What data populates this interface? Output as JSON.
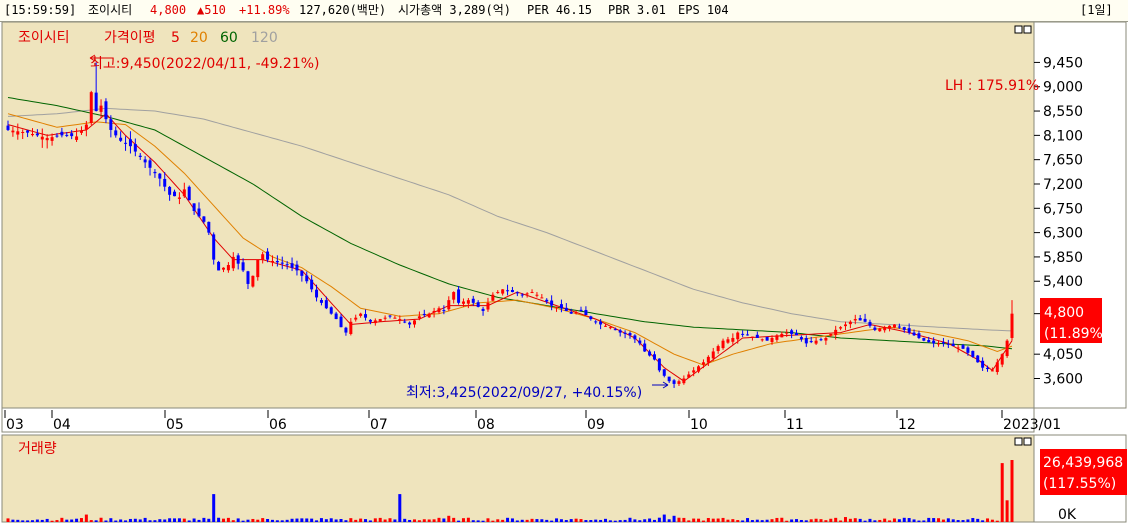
{
  "header": {
    "time": "[15:59:59]",
    "name": "조이시티",
    "price": "4,800",
    "change": "▲510",
    "change_pct": "+11.89%",
    "volume": "127,620(백만)",
    "market_cap": "시가총액  3,289(억)",
    "per": "PER 46.15",
    "pbr": "PBR 3.01",
    "eps": "EPS 104",
    "period": "[1일]"
  },
  "price_panel": {
    "title": "조이시티",
    "ma_label": "가격이평",
    "ma_periods": [
      "5",
      "20",
      "60",
      "120"
    ],
    "ma_colors": [
      "#e00000",
      "#e08000",
      "#006400",
      "#a0a0a0"
    ],
    "high_annotation": "최고:9,450(2022/04/11, -49.21%)",
    "low_annotation": "최저:3,425(2022/09/27, +40.15%)",
    "lh_label": "LH : 175.91%",
    "current_price": "4,800",
    "current_pct": "(11.89%)"
  },
  "volume_panel": {
    "title": "거래량",
    "current_volume": "26,439,968",
    "current_pct": "(117.55%)",
    "zero_label": "0K"
  },
  "chart_data": {
    "type": "candlestick",
    "x_ticks": [
      "03",
      "04",
      "05",
      "06",
      "07",
      "08",
      "09",
      "10",
      "11",
      "12",
      "2023/01"
    ],
    "y_ticks": [
      9450,
      9000,
      8550,
      8100,
      7650,
      7200,
      6750,
      6300,
      5850,
      5400,
      4800,
      4050,
      3600
    ],
    "y_tick_labels": [
      "9,450",
      "9,000",
      "8,550",
      "8,100",
      "7,650",
      "7,200",
      "6,750",
      "6,300",
      "5,850",
      "5,400",
      "4,050",
      "3,600"
    ],
    "ylim": [
      3350,
      10050
    ],
    "high": {
      "value": 9450,
      "date": "2022/04/11"
    },
    "low": {
      "value": 3425,
      "date": "2022/09/27"
    },
    "last_close": 4800,
    "close_path": [
      [
        0,
        8200
      ],
      [
        4,
        8150
      ],
      [
        8,
        8050
      ],
      [
        11,
        8100
      ],
      [
        14,
        8080
      ],
      [
        16,
        8300
      ],
      [
        17,
        8900
      ],
      [
        18,
        8550
      ],
      [
        19,
        8650
      ],
      [
        20,
        8400
      ],
      [
        21,
        8200
      ],
      [
        23,
        8000
      ],
      [
        25,
        7900
      ],
      [
        27,
        7700
      ],
      [
        29,
        7500
      ],
      [
        31,
        7300
      ],
      [
        33,
        7000
      ],
      [
        35,
        6950
      ],
      [
        36,
        7100
      ],
      [
        37,
        6900
      ],
      [
        38,
        6700
      ],
      [
        40,
        6500
      ],
      [
        41,
        6300
      ],
      [
        42,
        5800
      ],
      [
        43,
        5600
      ],
      [
        45,
        5700
      ],
      [
        46,
        5850
      ],
      [
        48,
        5600
      ],
      [
        49,
        5350
      ],
      [
        50,
        5500
      ],
      [
        51,
        5800
      ],
      [
        52,
        5900
      ],
      [
        53,
        5800
      ],
      [
        55,
        5750
      ],
      [
        57,
        5700
      ],
      [
        59,
        5600
      ],
      [
        61,
        5400
      ],
      [
        63,
        5100
      ],
      [
        65,
        4900
      ],
      [
        67,
        4700
      ],
      [
        68,
        4550
      ],
      [
        69,
        4450
      ],
      [
        70,
        4650
      ],
      [
        72,
        4800
      ],
      [
        74,
        4650
      ],
      [
        76,
        4700
      ],
      [
        78,
        4750
      ],
      [
        80,
        4700
      ],
      [
        82,
        4600
      ],
      [
        84,
        4750
      ],
      [
        86,
        4800
      ],
      [
        88,
        4900
      ],
      [
        89,
        4850
      ],
      [
        90,
        5050
      ],
      [
        91,
        5200
      ],
      [
        92,
        5000
      ],
      [
        94,
        5050
      ],
      [
        95,
        5000
      ],
      [
        97,
        4850
      ],
      [
        98,
        5000
      ],
      [
        99,
        5150
      ],
      [
        101,
        5250
      ],
      [
        103,
        5200
      ],
      [
        105,
        5150
      ],
      [
        107,
        5200
      ],
      [
        109,
        5100
      ],
      [
        111,
        4950
      ],
      [
        113,
        4900
      ],
      [
        115,
        4800
      ],
      [
        117,
        4850
      ],
      [
        119,
        4700
      ],
      [
        121,
        4600
      ],
      [
        123,
        4550
      ],
      [
        125,
        4450
      ],
      [
        127,
        4400
      ],
      [
        129,
        4250
      ],
      [
        130,
        4100
      ],
      [
        132,
        3950
      ],
      [
        133,
        3750
      ],
      [
        134,
        3650
      ],
      [
        135,
        3550
      ],
      [
        136,
        3500
      ],
      [
        137,
        3550
      ],
      [
        138,
        3600
      ],
      [
        140,
        3750
      ],
      [
        142,
        3900
      ],
      [
        144,
        4100
      ],
      [
        146,
        4300
      ],
      [
        148,
        4350
      ],
      [
        149,
        4450
      ],
      [
        151,
        4400
      ],
      [
        153,
        4350
      ],
      [
        155,
        4300
      ],
      [
        157,
        4400
      ],
      [
        159,
        4450
      ],
      [
        161,
        4400
      ],
      [
        163,
        4250
      ],
      [
        165,
        4300
      ],
      [
        167,
        4350
      ],
      [
        169,
        4500
      ],
      [
        171,
        4600
      ],
      [
        173,
        4700
      ],
      [
        175,
        4650
      ],
      [
        177,
        4500
      ],
      [
        179,
        4550
      ],
      [
        181,
        4600
      ],
      [
        183,
        4500
      ],
      [
        185,
        4400
      ],
      [
        187,
        4300
      ],
      [
        189,
        4250
      ],
      [
        191,
        4250
      ],
      [
        193,
        4200
      ],
      [
        195,
        4150
      ],
      [
        197,
        4000
      ],
      [
        199,
        3800
      ],
      [
        201,
        3750
      ],
      [
        202,
        3900
      ],
      [
        203,
        4050
      ],
      [
        204,
        4300
      ],
      [
        205,
        4800
      ]
    ],
    "ma5_path": [
      [
        0,
        8300
      ],
      [
        8,
        8100
      ],
      [
        16,
        8200
      ],
      [
        20,
        8500
      ],
      [
        24,
        8100
      ],
      [
        30,
        7600
      ],
      [
        36,
        7000
      ],
      [
        42,
        6200
      ],
      [
        46,
        5800
      ],
      [
        52,
        5800
      ],
      [
        60,
        5600
      ],
      [
        66,
        5000
      ],
      [
        70,
        4600
      ],
      [
        76,
        4650
      ],
      [
        84,
        4700
      ],
      [
        90,
        4950
      ],
      [
        98,
        4950
      ],
      [
        104,
        5200
      ],
      [
        112,
        4950
      ],
      [
        120,
        4700
      ],
      [
        128,
        4350
      ],
      [
        134,
        3800
      ],
      [
        138,
        3550
      ],
      [
        144,
        3950
      ],
      [
        150,
        4350
      ],
      [
        160,
        4400
      ],
      [
        170,
        4450
      ],
      [
        176,
        4600
      ],
      [
        184,
        4450
      ],
      [
        192,
        4250
      ],
      [
        198,
        3950
      ],
      [
        201,
        3750
      ],
      [
        205,
        4300
      ]
    ],
    "ma20_path": [
      [
        0,
        8500
      ],
      [
        10,
        8250
      ],
      [
        18,
        8350
      ],
      [
        24,
        8300
      ],
      [
        30,
        7900
      ],
      [
        36,
        7400
      ],
      [
        42,
        6800
      ],
      [
        48,
        6200
      ],
      [
        54,
        5850
      ],
      [
        60,
        5650
      ],
      [
        66,
        5300
      ],
      [
        72,
        4900
      ],
      [
        80,
        4750
      ],
      [
        88,
        4800
      ],
      [
        96,
        5000
      ],
      [
        104,
        5050
      ],
      [
        112,
        4900
      ],
      [
        120,
        4700
      ],
      [
        128,
        4450
      ],
      [
        136,
        4050
      ],
      [
        142,
        3850
      ],
      [
        148,
        4050
      ],
      [
        156,
        4250
      ],
      [
        164,
        4350
      ],
      [
        172,
        4450
      ],
      [
        180,
        4550
      ],
      [
        188,
        4450
      ],
      [
        196,
        4300
      ],
      [
        202,
        4100
      ],
      [
        205,
        4200
      ]
    ],
    "ma60_path": [
      [
        0,
        8800
      ],
      [
        10,
        8650
      ],
      [
        20,
        8450
      ],
      [
        30,
        8200
      ],
      [
        40,
        7700
      ],
      [
        50,
        7200
      ],
      [
        60,
        6600
      ],
      [
        70,
        6100
      ],
      [
        80,
        5700
      ],
      [
        90,
        5350
      ],
      [
        100,
        5100
      ],
      [
        110,
        4950
      ],
      [
        120,
        4800
      ],
      [
        130,
        4650
      ],
      [
        140,
        4550
      ],
      [
        150,
        4500
      ],
      [
        160,
        4450
      ],
      [
        170,
        4350
      ],
      [
        180,
        4300
      ],
      [
        190,
        4250
      ],
      [
        200,
        4200
      ],
      [
        205,
        4150
      ]
    ],
    "ma120_path": [
      [
        0,
        8450
      ],
      [
        10,
        8500
      ],
      [
        20,
        8600
      ],
      [
        30,
        8550
      ],
      [
        40,
        8400
      ],
      [
        50,
        8150
      ],
      [
        60,
        7900
      ],
      [
        70,
        7600
      ],
      [
        80,
        7300
      ],
      [
        90,
        7000
      ],
      [
        100,
        6600
      ],
      [
        110,
        6300
      ],
      [
        120,
        5950
      ],
      [
        130,
        5600
      ],
      [
        140,
        5250
      ],
      [
        150,
        5000
      ],
      [
        160,
        4800
      ],
      [
        170,
        4650
      ],
      [
        180,
        4600
      ],
      [
        190,
        4550
      ],
      [
        200,
        4500
      ],
      [
        205,
        4480
      ]
    ],
    "volume_spikes": [
      {
        "i": 42,
        "v": 0.45
      },
      {
        "i": 80,
        "v": 0.45
      },
      {
        "i": 16,
        "v": 0.12
      },
      {
        "i": 90,
        "v": 0.1
      },
      {
        "i": 134,
        "v": 0.12
      },
      {
        "i": 136,
        "v": 0.1
      },
      {
        "i": 171,
        "v": 0.08
      },
      {
        "i": 203,
        "v": 0.95
      },
      {
        "i": 204,
        "v": 0.35
      },
      {
        "i": 205,
        "v": 1.0
      }
    ]
  }
}
